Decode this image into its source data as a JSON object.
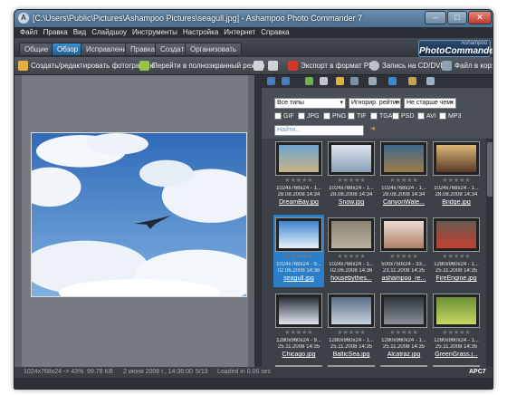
{
  "window": {
    "title": "[C:\\Users\\Public\\Pictures\\Ashampoo Pictures\\seagull.jpg] - Ashampoo Photo Commander 7",
    "controls": {
      "minimize": "–",
      "maximize": "□",
      "close": "✕"
    }
  },
  "menu": [
    "Файл",
    "Правка",
    "Вид",
    "Слайдшоу",
    "Инструменты",
    "Настройка",
    "Интернет",
    "Справка"
  ],
  "tabs": [
    "Общие",
    "Обзор",
    "Исправление",
    "Правка",
    "Создать",
    "Организовать"
  ],
  "active_tab": "Обзор",
  "logo": {
    "top": "Ashampoo",
    "bottom": "PhotoCommander7"
  },
  "actions": {
    "create_edit": "Создать/редактировать фотографию",
    "fullscreen": "Перейти в полноэкранный режим",
    "export_pdf": "Экспорт в формат PDF",
    "burn_cd": "Запись на CD/DVD",
    "file_to_basket": "Файл в корзин"
  },
  "filters": {
    "type": "Все типы",
    "rating": "Игнорир. рейтинг",
    "date": "Не старше чем..",
    "checkboxes": [
      "GIF",
      "JPG",
      "PNG",
      "TIF",
      "TGA",
      "PSD",
      "AVI",
      "MP3"
    ],
    "search_placeholder": "Найти..."
  },
  "thumbnails": [
    {
      "line1": "1024x768x24 - 1...",
      "line2": "28.08.2008 14:34",
      "name": "DreamBay.jpg",
      "selected": false
    },
    {
      "line1": "1024x768x24 - 1...",
      "line2": "28.08.2008 14:34",
      "name": "Snow.jpg",
      "selected": false
    },
    {
      "line1": "1024x768x24 - 1...",
      "line2": "28.08.2008 14:34",
      "name": "CanyonWate...",
      "selected": false
    },
    {
      "line1": "1024x768x24 - 1...",
      "line2": "28.08.2008 14:34",
      "name": "Bridge.jpg",
      "selected": false
    },
    {
      "line1": "1024x768x24 - 9...",
      "line2": "02.06.2008 14:36",
      "name": "seagull.jpg",
      "selected": true
    },
    {
      "line1": "1024x768x24 - 1...",
      "line2": "02.06.2008 14:36",
      "name": "housebythes...",
      "selected": false
    },
    {
      "line1": "500x750x24 - 33...",
      "line2": "23.11.2008 14:35",
      "name": "ashampoo_re...",
      "selected": false
    },
    {
      "line1": "1280x960x24 - 1...",
      "line2": "25.11.2008 14:35",
      "name": "FireEngine.jpg",
      "selected": false
    },
    {
      "line1": "1280x960x24 - 9...",
      "line2": "25.11.2008 14:35",
      "name": "Chicago.jpg",
      "selected": false
    },
    {
      "line1": "1280x960x24 - 1...",
      "line2": "25.11.2008 14:35",
      "name": "BalticSea.jpg",
      "selected": false
    },
    {
      "line1": "1280x960x24 - 1...",
      "line2": "25.11.2008 14:35",
      "name": "Alcatraz.jpg",
      "selected": false
    },
    {
      "line1": "1280x960x24 - 1...",
      "line2": "25.11.2008 14:35",
      "name": "GreenGrass.j...",
      "selected": false
    }
  ],
  "stars": "★★★★★",
  "status": {
    "dims": "1024x768x24 -> 43%",
    "size": "99.78 KB",
    "date": "2 июня 2008 г., 14:36:00",
    "position": "5/19",
    "loaded": "Loaded in 0.06 sec",
    "brand": "APC7"
  },
  "colors": {
    "accent": "#2a7fc8",
    "panel": "#3c4148",
    "viewer_bg": "#767b82"
  }
}
